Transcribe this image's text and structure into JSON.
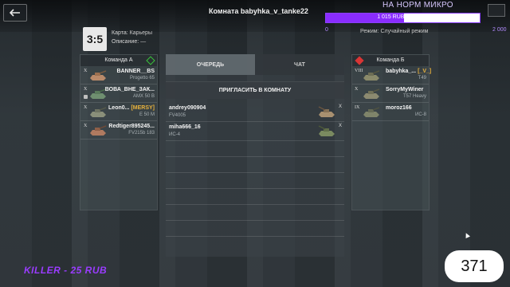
{
  "header": {
    "room_title": "Комната babyhka_v_tanke22"
  },
  "donation": {
    "title": "НА НОРМ МИКРО",
    "bar_text": "1 015 RUB (50.75%)",
    "progress": 0.5075,
    "min_label": "0",
    "max_label": "2 000",
    "accent_color": "#8a2cff"
  },
  "match": {
    "score": "3:5",
    "map_label": "Карта:",
    "map_value": "Карьеры",
    "desc_label": "Описание:",
    "desc_value": "—",
    "mode_label": "Режим:",
    "mode_value": "Случайный режим"
  },
  "team_a": {
    "title": "Команда А",
    "players": [
      {
        "tier": "X",
        "name": "BANNER__BS",
        "clan": "",
        "tank": "Progetto 65"
      },
      {
        "tier": "X",
        "name": "ВОВА_ВНЕ_ЗАК...",
        "clan": "",
        "tank": "AMX 50 B"
      },
      {
        "tier": "X",
        "name": "Leon0...",
        "clan": "[MERSY]",
        "tank": "E 50 M"
      },
      {
        "tier": "X",
        "name": "Redtiger895245...",
        "clan": "",
        "tank": "FV215b 183"
      }
    ]
  },
  "team_b": {
    "title": "Команда Б",
    "players": [
      {
        "tier": "VIII",
        "name": "babyhka_...",
        "clan": "[_V_]",
        "tank": "T49"
      },
      {
        "tier": "X",
        "name": "SorryMyWiner",
        "clan": "",
        "tank": "T57 Heavy"
      },
      {
        "tier": "IX",
        "name": "moroz166",
        "clan": "",
        "tank": "ИС-8"
      }
    ]
  },
  "center": {
    "tab_queue": "ОЧЕРЕДЬ",
    "tab_chat": "ЧАТ",
    "invite_label": "ПРИГЛАСИТЬ В КОМНАТУ",
    "queue": [
      {
        "name": "andrey090904",
        "tank": "FV4005",
        "tier": "X"
      },
      {
        "name": "miha666_16",
        "tank": "ИС-4",
        "tier": "X"
      }
    ]
  },
  "overlay": {
    "killer_text": "KILLER - 25 RUB",
    "counter_value": "371"
  }
}
